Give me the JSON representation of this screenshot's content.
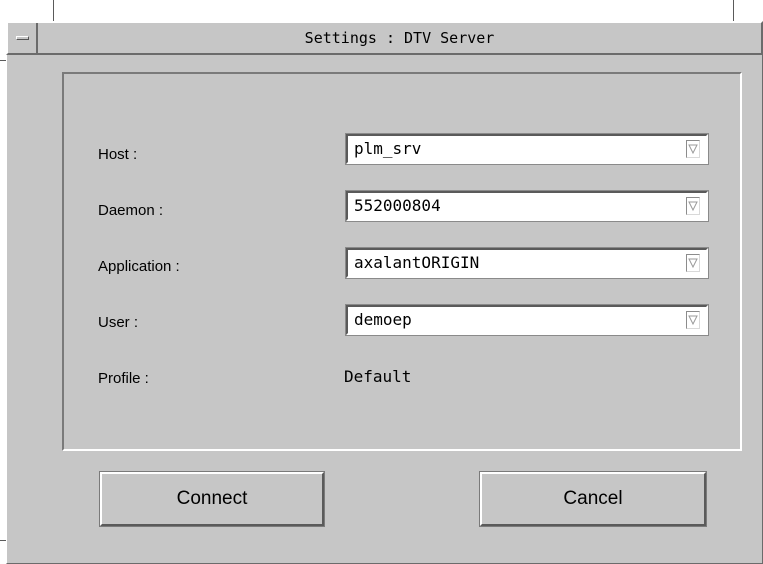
{
  "window": {
    "title": "Settings : DTV Server"
  },
  "form": {
    "host": {
      "label": "Host :",
      "value": "plm_srv"
    },
    "daemon": {
      "label": "Daemon :",
      "value": "552000804"
    },
    "application": {
      "label": "Application :",
      "value": "axalantORIGIN"
    },
    "user": {
      "label": "User :",
      "value": "demoep"
    },
    "profile": {
      "label": "Profile :",
      "value": "Default"
    }
  },
  "buttons": {
    "connect": "Connect",
    "cancel": "Cancel"
  },
  "icons": {
    "window_menu": "window-menu-icon",
    "combo_arrow": "combo-arrow-icon"
  },
  "colors": {
    "window_bg": "#c6c6c6",
    "field_bg": "#ffffff",
    "shadow": "#5a5a5a",
    "highlight": "#ffffff"
  }
}
